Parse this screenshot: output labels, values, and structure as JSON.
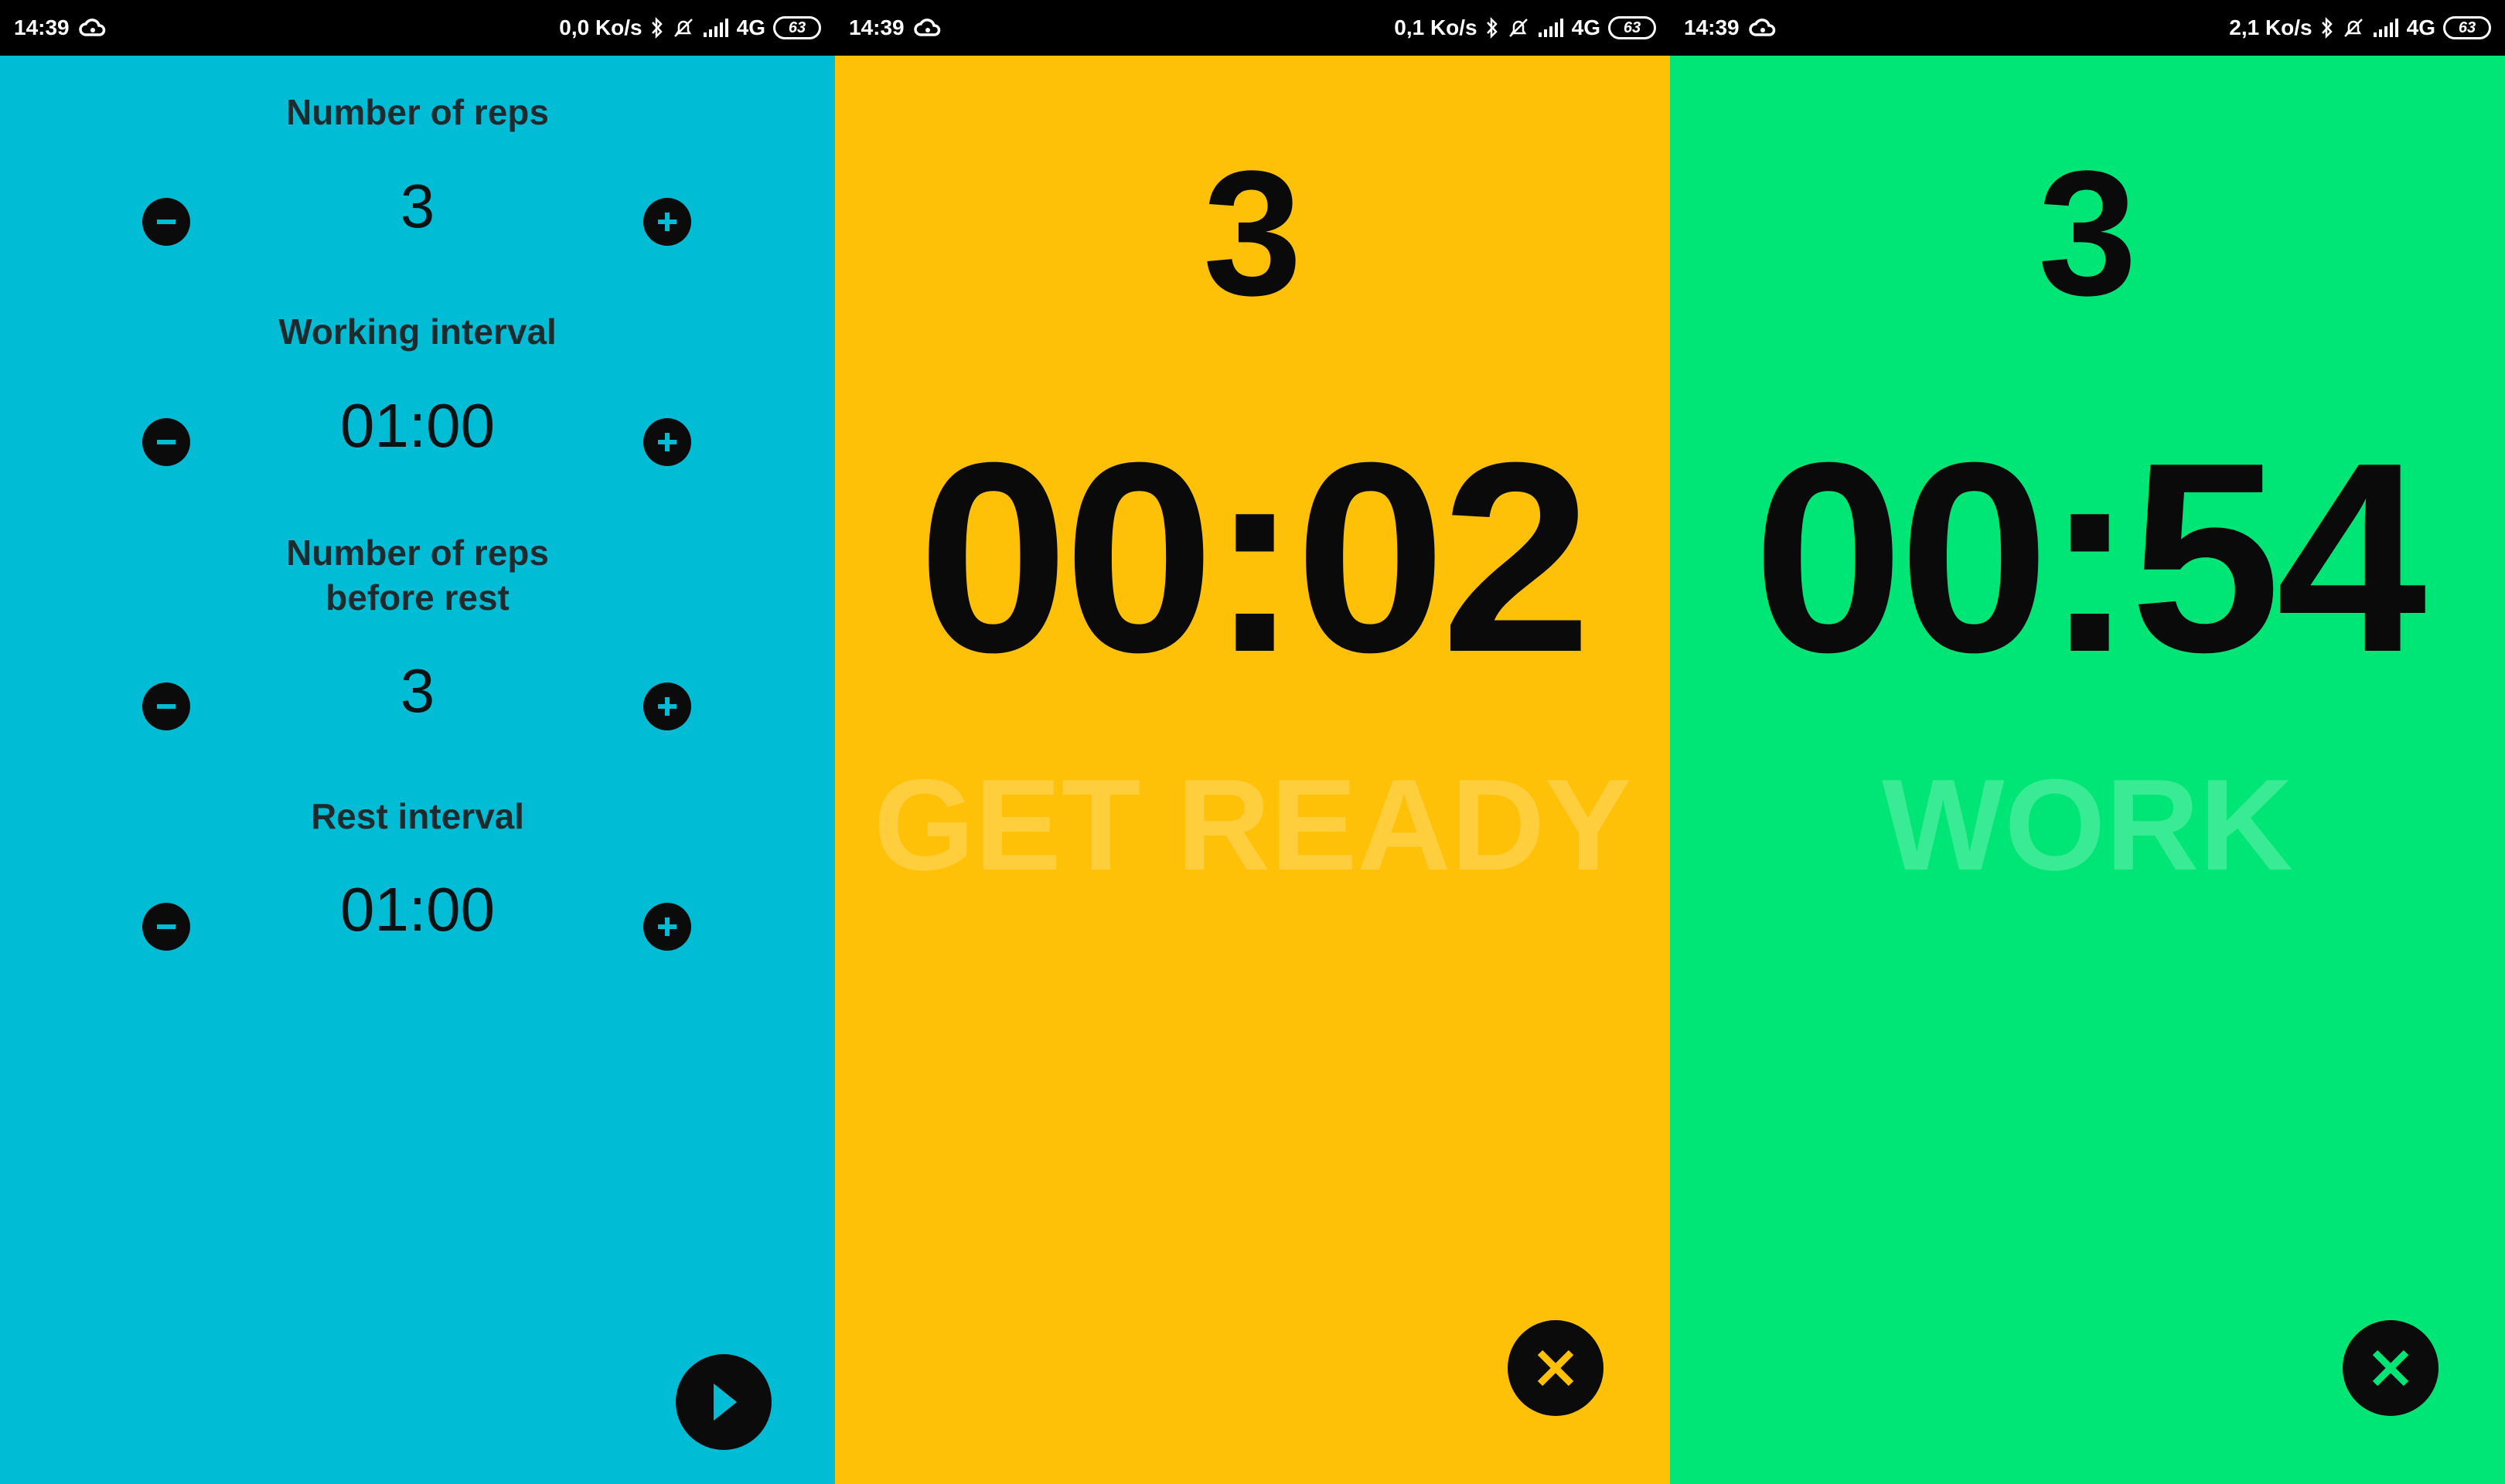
{
  "colors": {
    "setup_bg": "#00bcd4",
    "ready_bg": "#ffc107",
    "work_bg": "#00e676",
    "button_bg": "#0b0b0b"
  },
  "status_bars": [
    {
      "time": "14:39",
      "net_speed": "0,0 Ko/s",
      "network": "4G",
      "battery": "63"
    },
    {
      "time": "14:39",
      "net_speed": "0,1 Ko/s",
      "network": "4G",
      "battery": "63"
    },
    {
      "time": "14:39",
      "net_speed": "2,1 Ko/s",
      "network": "4G",
      "battery": "63"
    }
  ],
  "setup": {
    "reps": {
      "label": "Number of reps",
      "value": "3"
    },
    "working_interval": {
      "label": "Working interval",
      "value": "01:00"
    },
    "reps_before_rest": {
      "label_line1": "Number of reps",
      "label_line2": "before rest",
      "value": "3"
    },
    "rest_interval": {
      "label": "Rest interval",
      "value": "01:00"
    },
    "icons": {
      "minus": "minus-icon",
      "plus": "plus-icon",
      "play": "play-icon"
    }
  },
  "ready_screen": {
    "rep": "3",
    "time": "00:02",
    "phase": "GET READY",
    "close_icon": "close-icon"
  },
  "work_screen": {
    "rep": "3",
    "time": "00:54",
    "phase": "WORK",
    "close_icon": "close-icon"
  }
}
